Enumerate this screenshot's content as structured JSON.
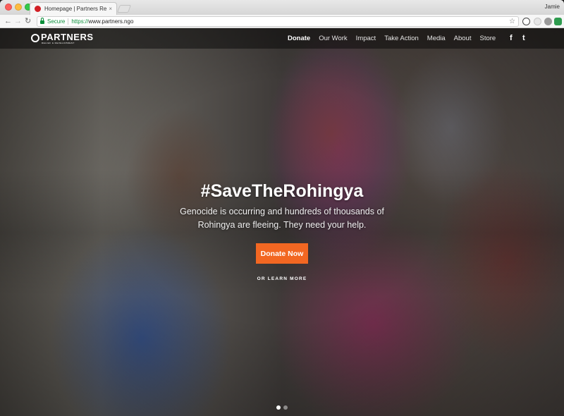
{
  "browser": {
    "tab_title": "Homepage | Partners Relief & D",
    "tab_close": "×",
    "profile_name": "Jamie",
    "back": "←",
    "forward": "→",
    "reload": "↻",
    "secure_label": "Secure",
    "url_scheme": "https://",
    "url_host": "www.partners.ngo",
    "bookmark_star": "☆"
  },
  "site": {
    "logo_text": "PARTNERS",
    "logo_sub": "RELIEF & DEVELOPMENT",
    "nav": [
      "Donate",
      "Our Work",
      "Impact",
      "Take Action",
      "Media",
      "About",
      "Store"
    ],
    "social": {
      "facebook": "f",
      "twitter": "t"
    }
  },
  "hero": {
    "title_light": "#SaveThe",
    "title_bold": "Rohingya",
    "subtitle": "Genocide is occurring and hundreds of thousands of Rohingya are fleeing. They need your help.",
    "cta_label": "Donate Now",
    "cta_color": "#f26722",
    "learn_more": "OR LEARN MORE",
    "slides": 2,
    "active_slide": 1
  }
}
